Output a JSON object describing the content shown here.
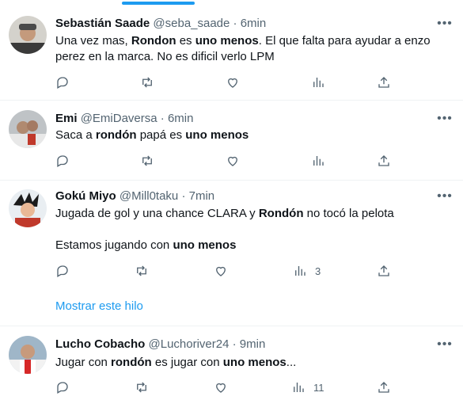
{
  "tweets": [
    {
      "name": "Sebastián Saade",
      "handle": "@seba_saade",
      "time": "6min",
      "text_parts": [
        "Una vez mas, ",
        "Rondon",
        " es ",
        "uno menos",
        ". El que falta para ayudar a enzo perez en la marca. No es dificil verlo LPM"
      ],
      "views": ""
    },
    {
      "name": "Emi",
      "handle": "@EmiDaversa",
      "time": "6min",
      "text_parts": [
        "Saca a ",
        "rondón",
        " papá es ",
        "uno menos"
      ],
      "views": ""
    },
    {
      "name": "Gokú Miyo",
      "handle": "@Mill0taku",
      "time": "7min",
      "text_parts": [
        "Jugada de gol y una chance CLARA y ",
        "Rondón",
        " no tocó la pelota"
      ],
      "text2_parts": [
        "Estamos jugando con ",
        "uno menos"
      ],
      "views": "3",
      "show_thread": "Mostrar este hilo"
    },
    {
      "name": "Lucho Cobacho",
      "handle": "@Luchoriver24",
      "time": "9min",
      "text_parts": [
        "Jugar con ",
        "rondón",
        " es jugar con ",
        "uno menos",
        "..."
      ],
      "views": "11"
    }
  ],
  "separator": "·",
  "icons": [
    "reply-icon",
    "retweet-icon",
    "like-icon",
    "views-icon",
    "share-icon",
    "more-icon"
  ],
  "colors": {
    "accent": "#1d9bf0",
    "secondary_text": "#536471",
    "text": "#0f1419",
    "divider": "#eff3f4"
  }
}
